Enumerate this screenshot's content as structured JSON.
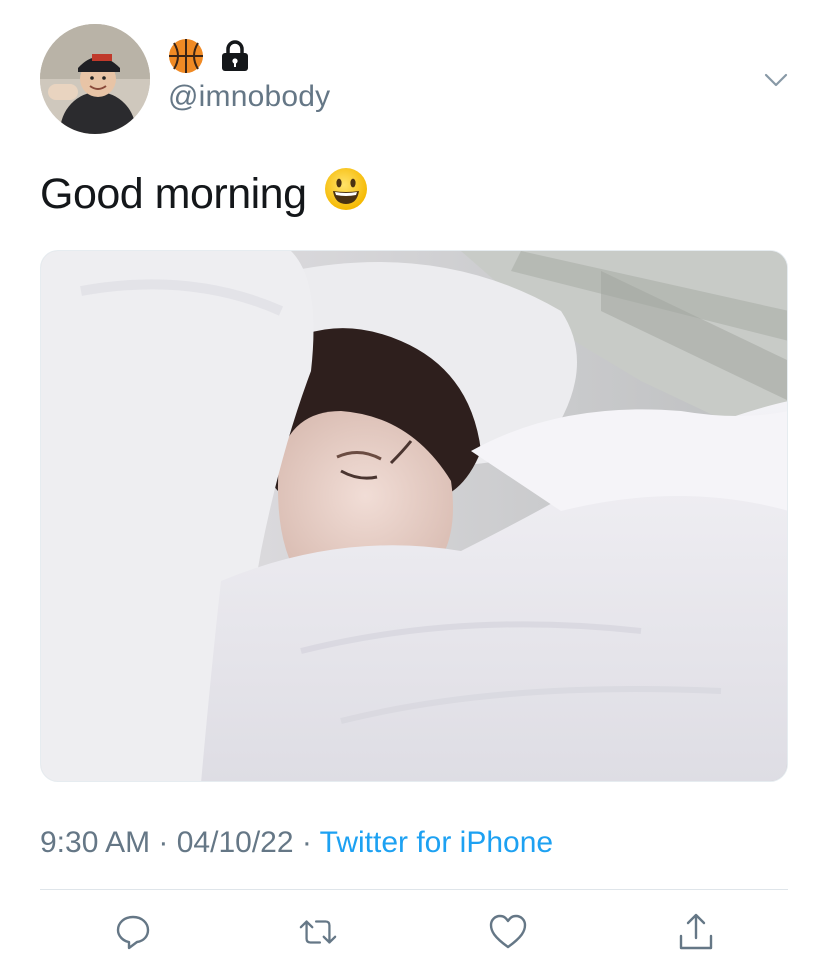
{
  "user": {
    "handle": "@imnobody",
    "name_icons": [
      "basketball-icon",
      "lock-icon"
    ]
  },
  "tweet": {
    "text": "Good morning",
    "emoji": "smiling-face-icon"
  },
  "meta": {
    "time": "9:30 AM",
    "separator1": " · ",
    "date": "04/10/22",
    "separator2": " · ",
    "source": "Twitter for iPhone"
  },
  "actions": [
    "reply-icon",
    "retweet-icon",
    "like-icon",
    "share-icon"
  ],
  "colors": {
    "link": "#1da1f2",
    "secondary_text": "#657786",
    "primary_text": "#14171a",
    "divider": "#dfe5ea"
  }
}
